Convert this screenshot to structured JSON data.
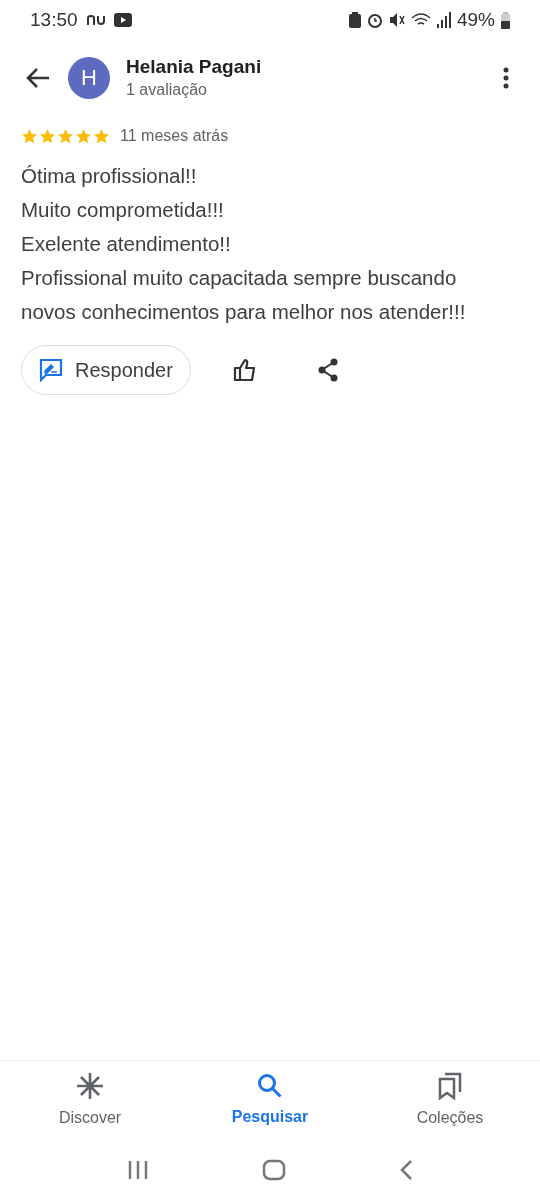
{
  "status_bar": {
    "time": "13:50",
    "battery": "49%"
  },
  "header": {
    "avatar_letter": "H",
    "name": "Helania Pagani",
    "subtitle": "1 avaliação"
  },
  "review": {
    "stars": 5,
    "time": "11 meses atrás",
    "lines": [
      "Ótima profissional!!",
      "Muito comprometida!!!",
      "Exelente atendimento!!",
      "Profissional muito capacitada sempre buscando novos conhecimentos para melhor nos atender!!!"
    ]
  },
  "actions": {
    "reply_label": "Responder"
  },
  "tabs": [
    {
      "kind": "discover",
      "label": "Discover",
      "selected": false
    },
    {
      "kind": "search",
      "label": "Pesquisar",
      "selected": true
    },
    {
      "kind": "collections",
      "label": "Coleções",
      "selected": false
    }
  ]
}
